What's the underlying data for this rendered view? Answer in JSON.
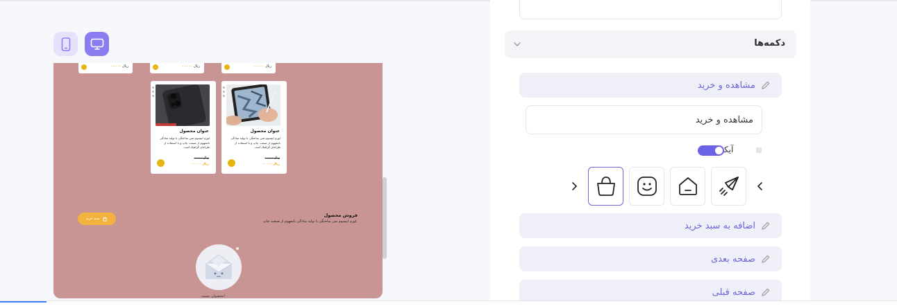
{
  "preview": {
    "device_buttons": [
      {
        "name": "mobile",
        "active": false
      },
      {
        "name": "desktop",
        "active": true
      }
    ],
    "background_color": "#c99594",
    "top_row_cards": [
      {
        "price": "۰۰۰۰۰",
        "currency": "ریال"
      },
      {
        "price": "۰۰۰۰۰",
        "currency": "ریال"
      },
      {
        "price": "۰۰۰۰۰",
        "currency": "ریال"
      }
    ],
    "cards": [
      {
        "title": "عنوان محصول",
        "description": "لورم ایپسوم متن ساختگی با تولید سادگی نامفهوم از صنعت چاپ و با استفاده از طراحان گرافیک است",
        "old_price": "۰۰۰۰۰ ریال",
        "price": "۰۰۰۰۰ ریال",
        "image": "tablet-image"
      },
      {
        "title": "عنوان محصول",
        "description": "لورم ایپسوم متن ساختگی با تولید سادگی نامفهوم از صنعت چاپ و با استفاده از طراحان گرافیک است",
        "old_price": "۰۰۰۰۰ ریال",
        "price": "۰۰۰۰۰ ریال",
        "image": "phone-image"
      }
    ],
    "hero": {
      "title": "فروش محصول",
      "description": "لورم ایپسوم متن ساختگی با تولید سادگی نامفهوم از صنعت چاپ.",
      "button_label": "سبد خرید"
    },
    "empty_state": {
      "label": "محصولی نیست!"
    }
  },
  "settings": {
    "section_title": "دکمه‌ها",
    "view_buy_pill": "مشاهده و خرید",
    "button_text_value": "مشاهده و خرید",
    "icon_label": "آیکون",
    "icon_toggle_on": true,
    "icons": [
      "rocket-icon",
      "home-icon",
      "smile-icon",
      "bag-icon"
    ],
    "selected_icon": "bag-icon",
    "add_to_cart_pill": "اضافه به سبد خرید",
    "next_page_pill": "صفحه بعدی",
    "prev_page_pill": "صفحه قبلی"
  },
  "colors": {
    "accent": "#6c62e6",
    "accent_text": "#6b63d8",
    "yellow": "#e7b512",
    "orange_button": "#f3b23e"
  }
}
